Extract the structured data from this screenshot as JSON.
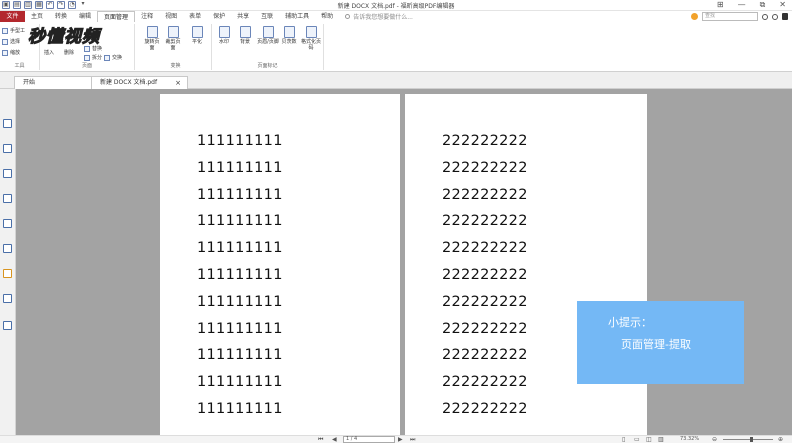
{
  "window": {
    "title": "新建 DOCX 文档.pdf - 福昕高级PDF编辑器",
    "controls": [
      "⊞",
      "—",
      "⧉",
      "✕"
    ]
  },
  "quick_access": [
    "▣",
    "▤",
    "▥",
    "▦",
    "↶",
    "↷",
    "◔",
    "▾"
  ],
  "menubar": {
    "file": "文件",
    "tabs": [
      "主页",
      "转换",
      "编辑",
      "页面管理",
      "注释",
      "视图",
      "表单",
      "保护",
      "共享",
      "互联",
      "辅助工具",
      "帮助"
    ],
    "active_tab": "页面管理",
    "tell_me": "告诉我您想要做什么...",
    "search_placeholder": "查找"
  },
  "logo": "秒懂视频",
  "ribbon": {
    "tools_group": {
      "label": "工具",
      "items": [
        "手型工",
        "选择",
        "缩放"
      ]
    },
    "pages_group": {
      "label": "页面",
      "items": [
        "插入",
        "删除",
        "替换",
        "拆分",
        "交换",
        "旋转页面",
        "裁剪页面",
        "平化"
      ]
    },
    "transform_group": {
      "label": "变换"
    },
    "page_marks_group": {
      "label": "页面标记",
      "items": [
        "水印",
        "背景",
        "页眉/页脚",
        "贝茨数",
        "格式化页码"
      ]
    }
  },
  "doc_tabs": [
    {
      "label": "开始",
      "closable": false
    },
    {
      "label": "新建 DOCX 文档.pdf",
      "closable": true
    }
  ],
  "page_left_lines": [
    "111111111",
    "111111111",
    "111111111",
    "111111111",
    "111111111",
    "111111111",
    "111111111",
    "111111111",
    "111111111",
    "111111111",
    "111111111"
  ],
  "page_right_lines": [
    "222222222",
    "222222222",
    "222222222",
    "222222222",
    "222222222",
    "222222222",
    "222222222",
    "222222222",
    "222222222",
    "222222222",
    "222222222"
  ],
  "hint": {
    "title": "小提示：",
    "body": "页面管理-提取"
  },
  "statusbar": {
    "page_indicator": "1 / 4",
    "zoom": "73.32%"
  },
  "colors": {
    "file_tab": "#b3282d",
    "canvas": "#a3a3a3",
    "hint": "#74b8f5"
  }
}
